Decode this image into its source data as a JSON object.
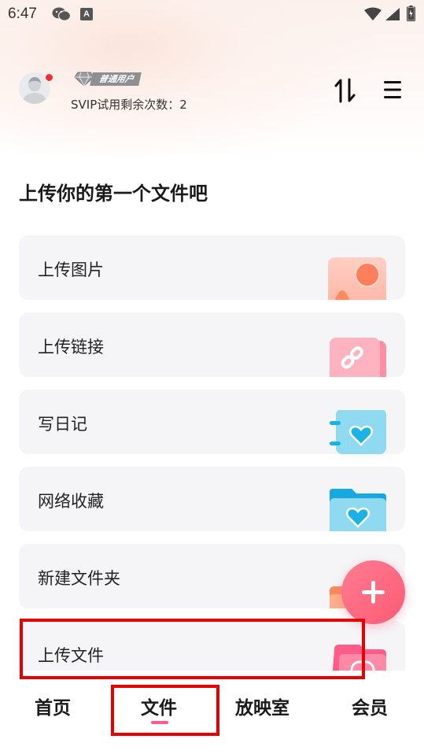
{
  "status_bar": {
    "time": "6:47",
    "a_badge": "A"
  },
  "header": {
    "vip_label": "普通用户",
    "svip_text": "SVIP试用剩余次数：2"
  },
  "section_title": "上传你的第一个文件吧",
  "cards": [
    {
      "label": "上传图片",
      "icon": "image-upload-icon"
    },
    {
      "label": "上传链接",
      "icon": "link-icon"
    },
    {
      "label": "写日记",
      "icon": "diary-icon"
    },
    {
      "label": "网络收藏",
      "icon": "favorite-folder-icon"
    },
    {
      "label": "新建文件夹",
      "icon": "new-folder-icon"
    },
    {
      "label": "上传文件",
      "icon": "file-upload-icon"
    }
  ],
  "bottom_nav": {
    "items": [
      {
        "label": "首页"
      },
      {
        "label": "文件",
        "active": true
      },
      {
        "label": "放映室"
      },
      {
        "label": "会员"
      }
    ]
  },
  "colors": {
    "accent": "#ff5c8a",
    "fab": "#fe5a74",
    "highlight": "#e60000",
    "card_bg": "#f5f5f8"
  }
}
